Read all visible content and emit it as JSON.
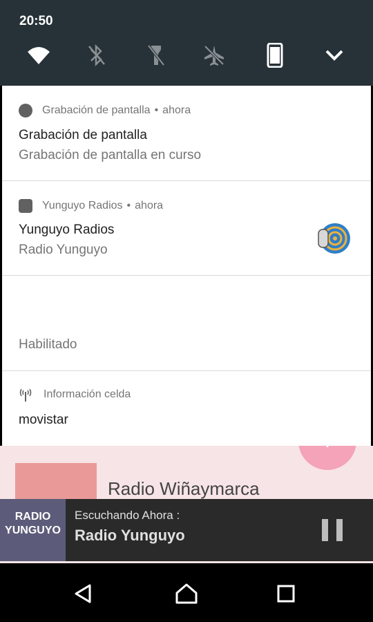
{
  "status_bar": {
    "time": "20:50"
  },
  "quick_settings": {
    "icons": [
      "wifi-icon",
      "bluetooth-off-icon",
      "flashlight-off-icon",
      "airplane-mode-off-icon",
      "phone-rotation-icon",
      "chevron-down-icon"
    ]
  },
  "notifications": [
    {
      "app": "Grabación de pantalla",
      "when": "ahora",
      "title": "Grabación de pantalla",
      "text": "Grabación de pantalla en curso"
    },
    {
      "app": "Yunguyo Radios",
      "when": "ahora",
      "title": "Yunguyo Radios",
      "text": "Radio Yunguyo"
    },
    {
      "title": "",
      "text": "Habilitado"
    },
    {
      "app": "Información celda",
      "text": "movistar"
    }
  ],
  "header_separator": "•",
  "background_app": {
    "list_item_title": "Radio Wiñaymarca",
    "fab_label": "+",
    "logo_text": "RADIO YUNGUYO",
    "player": {
      "subtitle": "Escuchando Ahora :",
      "title": "Radio Yunguyo"
    }
  },
  "colors": {
    "qs_bg": "#263238",
    "accent": "#e91e63"
  }
}
